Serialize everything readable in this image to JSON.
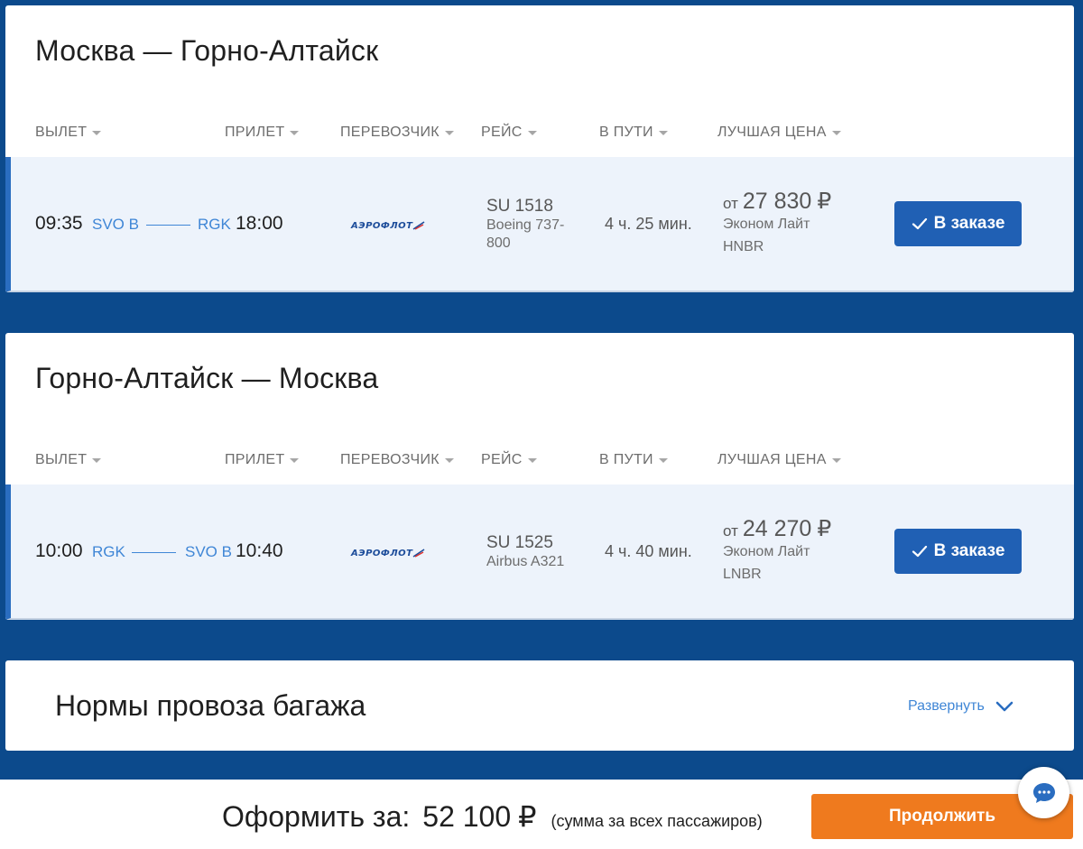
{
  "flights": [
    {
      "title": "Москва — Горно-Алтайск",
      "headers": {
        "departure": "ВЫЛЕТ",
        "arrival": "ПРИЛЕТ",
        "carrier": "ПЕРЕВОЗЧИК",
        "flight": "РЕЙС",
        "duration": "В ПУТИ",
        "best_price": "ЛУЧШАЯ ЦЕНА"
      },
      "row": {
        "dep_time": "09:35",
        "dep_airport": "SVO B",
        "arr_airport": "RGK",
        "arr_time": "18:00",
        "carrier_logo": "АЭРОФЛОТ",
        "flight_number": "SU 1518",
        "aircraft": "Boeing 737-800",
        "duration": "4 ч. 25 мин.",
        "price_from": "от",
        "price": "27 830",
        "currency": "₽",
        "fare": "Эконом Лайт",
        "fare_code": "HNBR",
        "order_label": "В заказе"
      }
    },
    {
      "title": "Горно-Алтайск — Москва",
      "headers": {
        "departure": "ВЫЛЕТ",
        "arrival": "ПРИЛЕТ",
        "carrier": "ПЕРЕВОЗЧИК",
        "flight": "РЕЙС",
        "duration": "В ПУТИ",
        "best_price": "ЛУЧШАЯ ЦЕНА"
      },
      "row": {
        "dep_time": "10:00",
        "dep_airport": "RGK",
        "arr_airport": "SVO B",
        "arr_time": "10:40",
        "carrier_logo": "АЭРОФЛОТ",
        "flight_number": "SU 1525",
        "aircraft": "Airbus A321",
        "duration": "4 ч. 40 мин.",
        "price_from": "от",
        "price": "24 270",
        "currency": "₽",
        "fare": "Эконом Лайт",
        "fare_code": "LNBR",
        "order_label": "В заказе"
      }
    }
  ],
  "baggage": {
    "title": "Нормы провоза багажа",
    "expand_label": "Развернуть"
  },
  "footer": {
    "total_label": "Оформить за:",
    "total_value": "52 100",
    "currency": "₽",
    "total_note": "(сумма за всех пассажиров)",
    "continue_label": "Продолжить"
  },
  "icons": {
    "sort": "caret-down-icon",
    "order": "check-icon",
    "expand": "chevron-down-icon",
    "chat": "chat-bubble-icon"
  },
  "colors": {
    "background": "#0c4a8c",
    "accent_blue": "#2060b4",
    "link_blue": "#3f86d6",
    "row_bg": "#edf3fb",
    "orange": "#ef7a1e"
  }
}
